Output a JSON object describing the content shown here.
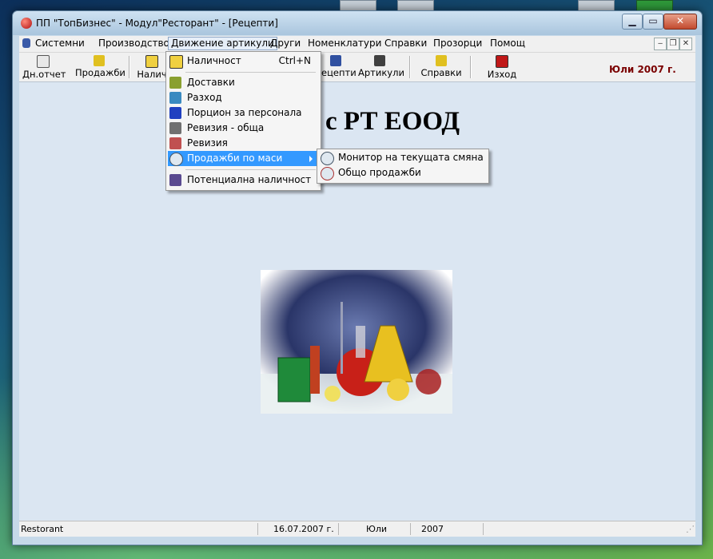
{
  "window": {
    "title": "ПП \"ТопБизнес\" - Модул\"Ресторант\" - [Рецепти]"
  },
  "menubar": {
    "items": [
      {
        "label": "Системни"
      },
      {
        "label": "Производство"
      },
      {
        "label": "Движение артикули"
      },
      {
        "label": "Други"
      },
      {
        "label": "Номенклатури"
      },
      {
        "label": "Справки"
      },
      {
        "label": "Прозорци"
      },
      {
        "label": "Помощ"
      }
    ]
  },
  "toolbar": {
    "items": [
      {
        "label": "Дн.отчет",
        "icon": "report-icon"
      },
      {
        "label": "Продажби",
        "icon": "sales-icon"
      },
      {
        "label": "Налич",
        "icon": "stock-icon"
      },
      {
        "label": "ецепти",
        "icon": "recipes-icon"
      },
      {
        "label": "Артикули",
        "icon": "articles-icon"
      },
      {
        "label": "Справки",
        "icon": "reports-icon"
      },
      {
        "label": "Изход",
        "icon": "exit-icon"
      }
    ],
    "date_label": "Юли 2007 г."
  },
  "content": {
    "company": "с РТ ЕООД"
  },
  "dropdown": {
    "items": [
      {
        "label": "Наличност",
        "shortcut": "Ctrl+N",
        "icon": "stock-icon"
      },
      {
        "label": "Доставки",
        "icon": "truck-icon"
      },
      {
        "label": "Разход",
        "icon": "expense-icon"
      },
      {
        "label": "Порцион за персонала",
        "icon": "book-icon"
      },
      {
        "label": "Ревизия - обща",
        "icon": "calculator-icon"
      },
      {
        "label": "Ревизия",
        "icon": "eraser-icon"
      },
      {
        "label": "Продажби по маси",
        "icon": "magnifier-icon"
      },
      {
        "label": "Потенциална наличност",
        "icon": "books-icon"
      }
    ]
  },
  "submenu": {
    "items": [
      {
        "label": "Монитор на текущата смяна",
        "icon": "magnifier-icon"
      },
      {
        "label": "Общо продажби",
        "icon": "refresh-magnifier-icon"
      }
    ]
  },
  "statusbar": {
    "app": "Restorant",
    "date": "16.07.2007 г.",
    "month": "Юли",
    "year": "2007"
  }
}
